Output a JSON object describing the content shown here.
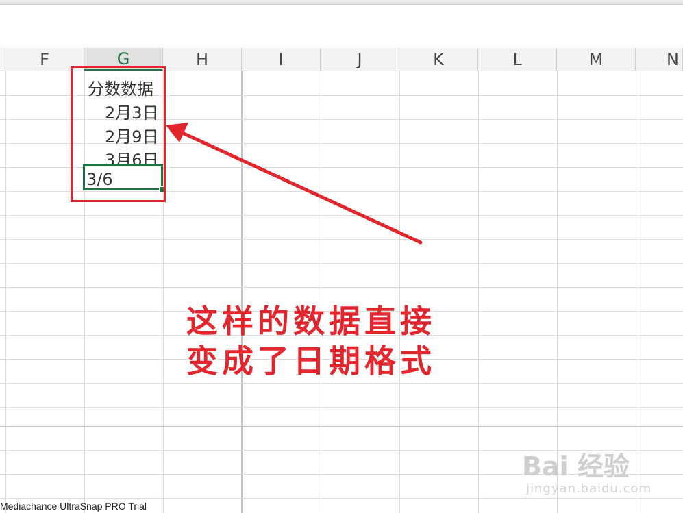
{
  "columns": [
    "F",
    "G",
    "H",
    "I",
    "J",
    "K",
    "L",
    "M",
    "N"
  ],
  "selected_column": "G",
  "cells": {
    "g1": "分数数据",
    "g2": "2月3日",
    "g3": "2月9日",
    "g4": "3月6日",
    "g5_editing": "3/6"
  },
  "annotation": {
    "line1": "这样的数据直接",
    "line2": "变成了日期格式"
  },
  "watermark": "Mediachance UltraSnap PRO Trial",
  "brand": {
    "logo_text": "Bai 经验",
    "url": "jingyan.baidu.com"
  },
  "colors": {
    "accent_green": "#217346",
    "annotation_red": "#e3262d"
  }
}
